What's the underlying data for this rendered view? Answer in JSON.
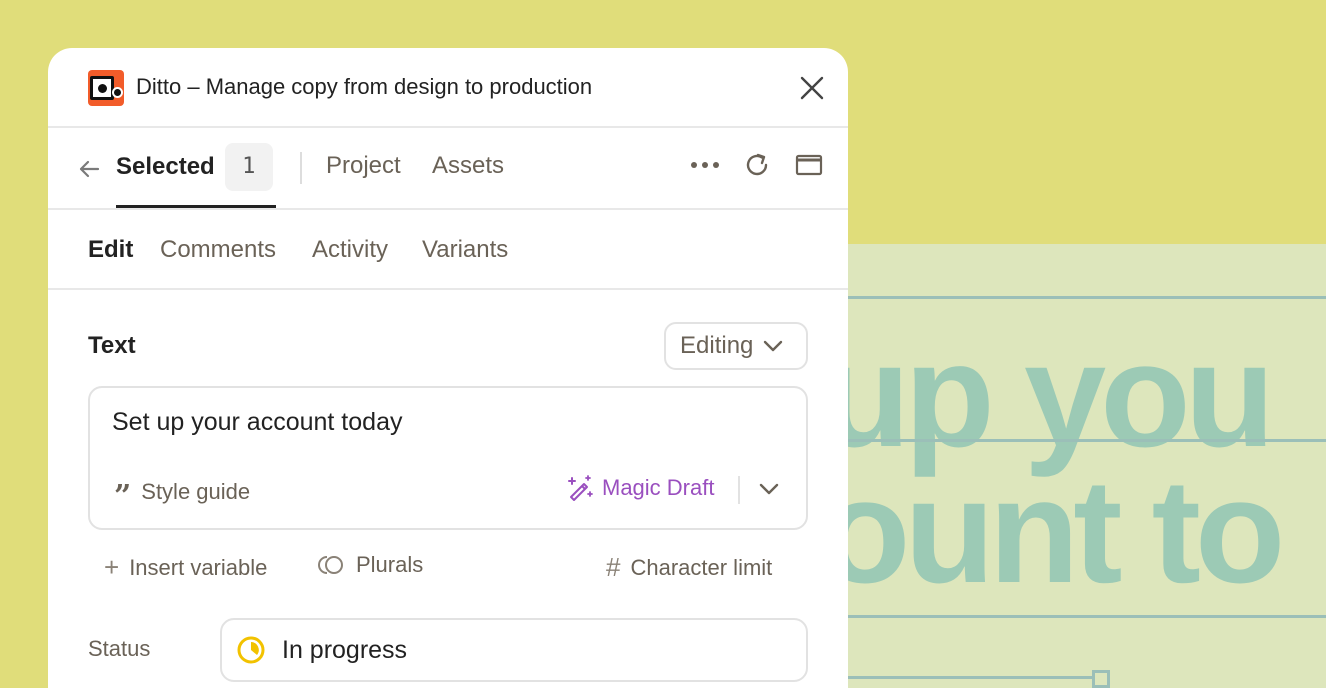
{
  "window": {
    "title": "Ditto – Manage copy from design to production"
  },
  "nav": {
    "selected_label": "Selected",
    "selected_count": "1",
    "project_label": "Project",
    "assets_label": "Assets"
  },
  "subtabs": {
    "edit": "Edit",
    "comments": "Comments",
    "activity": "Activity",
    "variants": "Variants"
  },
  "editor": {
    "section_label": "Text",
    "mode_label": "Editing",
    "text_value": "Set up your account today",
    "style_guide_label": "Style guide",
    "magic_draft_label": "Magic Draft",
    "insert_variable_label": "Insert variable",
    "plurals_label": "Plurals",
    "character_limit_label": "Character limit",
    "status_label": "Status",
    "status_value": "In progress"
  },
  "canvas": {
    "line1": "up you",
    "line2": "ount to"
  },
  "colors": {
    "background": "#e0dd7a",
    "canvas": "#dde6bc",
    "canvas_text": "#9ccab5",
    "magic": "#9a4fbf",
    "status_in_progress": "#f2c200",
    "logo": "#f25c2a"
  },
  "icons": {
    "close": "close-icon",
    "back": "arrow-left-icon",
    "more": "more-horizontal-icon",
    "refresh": "refresh-icon",
    "window": "window-icon",
    "chevron": "chevron-down-icon",
    "quote": "quote-icon",
    "magic": "magic-wand-icon",
    "plus": "plus-icon",
    "plurals": "plurals-icon",
    "hash": "hash-icon",
    "status": "status-in-progress-icon"
  }
}
